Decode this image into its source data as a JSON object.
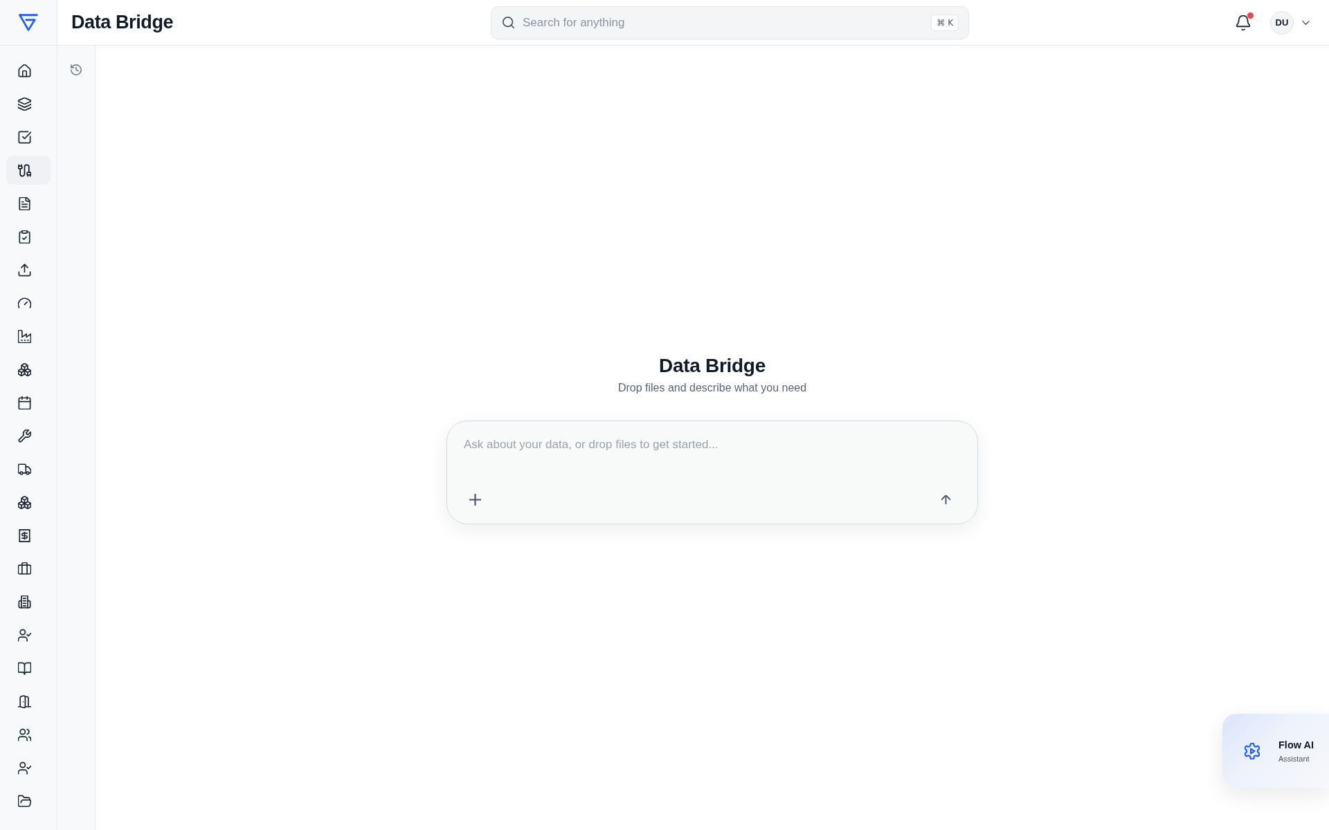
{
  "app": {
    "title": "Data Bridge"
  },
  "search": {
    "placeholder": "Search for anything",
    "shortcut": "⌘ K"
  },
  "notifications": {
    "unread": true
  },
  "user": {
    "initials": "DU"
  },
  "nav_rail": [
    {
      "selected": false
    },
    {
      "selected": false
    },
    {
      "selected": false
    },
    {
      "selected": true
    },
    {
      "selected": false
    },
    {
      "selected": false
    },
    {
      "selected": false
    },
    {
      "selected": false
    },
    {
      "selected": false
    },
    {
      "selected": false
    },
    {
      "selected": false
    },
    {
      "selected": false
    },
    {
      "selected": false
    },
    {
      "selected": false
    },
    {
      "selected": false
    },
    {
      "selected": false
    },
    {
      "selected": false
    },
    {
      "selected": false
    },
    {
      "selected": false
    },
    {
      "selected": false
    },
    {
      "selected": false
    },
    {
      "selected": false
    },
    {
      "selected": false
    }
  ],
  "main": {
    "title": "Data Bridge",
    "subtitle": "Drop files and describe what you need",
    "composer": {
      "placeholder": "Ask about your data, or drop files to get started..."
    }
  },
  "assistant_widget": {
    "title": "Flow AI",
    "subtitle": "Assistant"
  }
}
